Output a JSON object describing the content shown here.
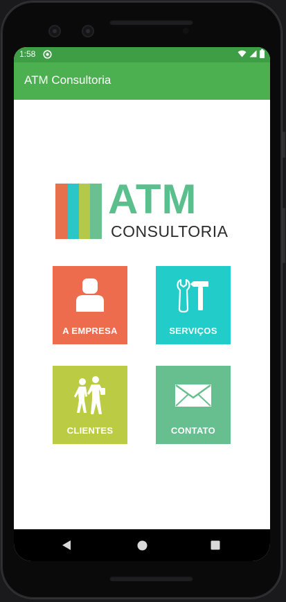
{
  "status_bar": {
    "time": "1:58",
    "left_icon": "sync-circle-icon",
    "right_icons": [
      "wifi-icon",
      "signal-icon",
      "battery-icon"
    ]
  },
  "app_bar": {
    "title": "ATM Consultoria"
  },
  "logo": {
    "word": "ATM",
    "subtitle": "CONSULTORIA",
    "word_color": "#5bbf8d",
    "stripe_colors": [
      "#e8704d",
      "#2bc6c8",
      "#b6c84a",
      "#6cc08f"
    ]
  },
  "menu": {
    "tiles": [
      {
        "label": "A EMPRESA",
        "icon": "person-icon",
        "color": "#ec6c4d"
      },
      {
        "label": "SERVIÇOS",
        "icon": "tools-icon",
        "color": "#22cdc9"
      },
      {
        "label": "CLIENTES",
        "icon": "people-walking-icon",
        "color": "#bccb44"
      },
      {
        "label": "CONTATO",
        "icon": "envelope-icon",
        "color": "#67bf8f"
      }
    ]
  },
  "nav_bar": {
    "buttons": [
      "back-icon",
      "home-icon",
      "recents-icon"
    ]
  }
}
